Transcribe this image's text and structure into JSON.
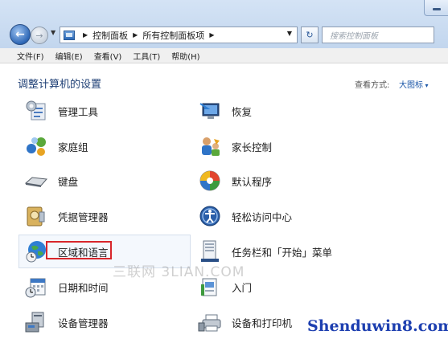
{
  "address_bar": {
    "segments": [
      "控制面板",
      "所有控制面板项"
    ]
  },
  "search": {
    "placeholder": "搜索控制面板"
  },
  "menu": [
    "文件(F)",
    "编辑(E)",
    "查看(V)",
    "工具(T)",
    "帮助(H)"
  ],
  "header": {
    "title": "调整计算机的设置",
    "view_by_label": "查看方式:",
    "view_by_value": "大图标"
  },
  "items_left": [
    {
      "label": "管理工具",
      "icon": "admin-tools-icon"
    },
    {
      "label": "家庭组",
      "icon": "homegroup-icon"
    },
    {
      "label": "键盘",
      "icon": "keyboard-icon"
    },
    {
      "label": "凭据管理器",
      "icon": "credential-manager-icon"
    },
    {
      "label": "区域和语言",
      "icon": "region-language-icon"
    },
    {
      "label": "日期和时间",
      "icon": "date-time-icon"
    },
    {
      "label": "设备管理器",
      "icon": "device-manager-icon"
    }
  ],
  "items_right": [
    {
      "label": "恢复",
      "icon": "recovery-icon"
    },
    {
      "label": "家长控制",
      "icon": "parental-controls-icon"
    },
    {
      "label": "默认程序",
      "icon": "default-programs-icon"
    },
    {
      "label": "轻松访问中心",
      "icon": "ease-of-access-icon"
    },
    {
      "label": "任务栏和「开始」菜单",
      "icon": "taskbar-start-icon"
    },
    {
      "label": "入门",
      "icon": "getting-started-icon"
    },
    {
      "label": "设备和打印机",
      "icon": "devices-printers-icon"
    }
  ],
  "watermarks": {
    "center": "三联网 3LIAN.COM",
    "corner": "Shenduwin8.com"
  },
  "colors": {
    "header": "#1e3f75",
    "highlight_border": "#d8262b",
    "link": "#1c57a8"
  }
}
